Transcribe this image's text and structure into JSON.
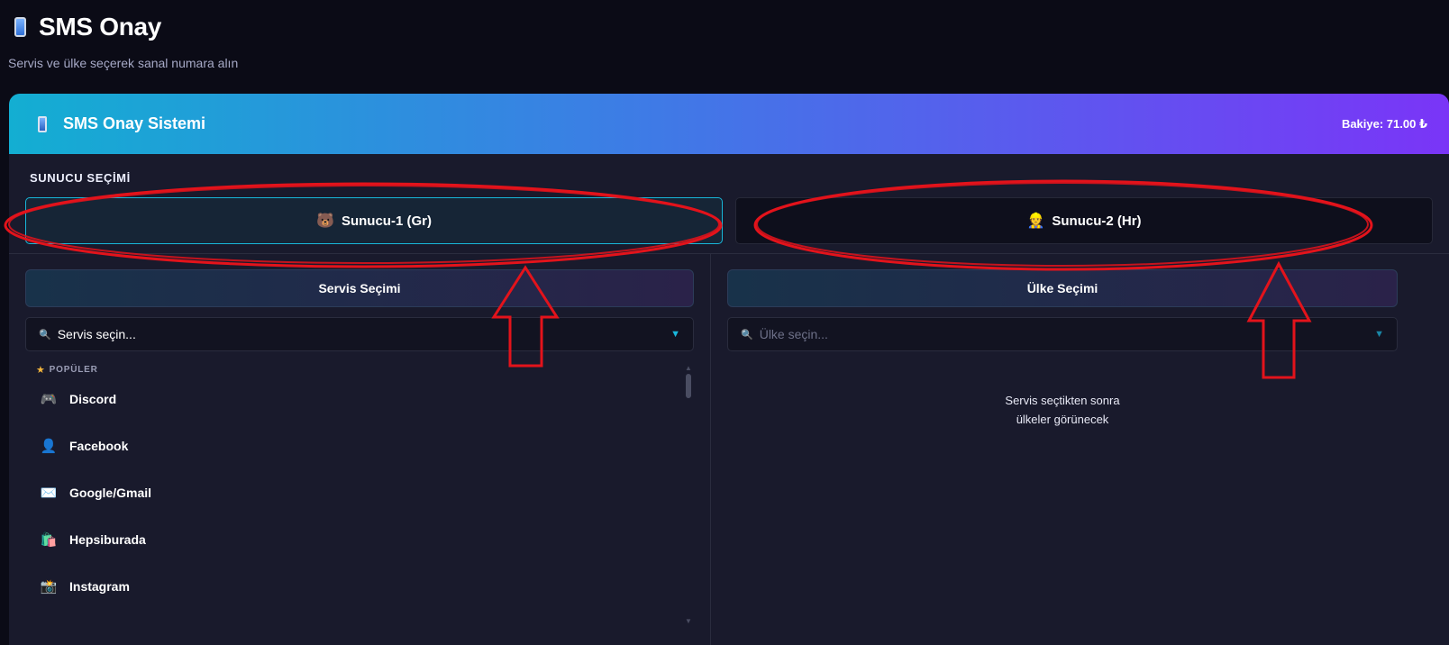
{
  "page": {
    "title": "SMS Onay",
    "subtitle": "Servis ve ülke seçerek sanal numara alın"
  },
  "card": {
    "title": "SMS Onay Sistemi",
    "balance": "Bakiye: 71.00 ₺"
  },
  "server_section": {
    "label": "SUNUCU SEÇİMİ",
    "servers": [
      {
        "emoji": "🐻",
        "label": "Sunucu-1 (Gr)",
        "active": true
      },
      {
        "emoji": "👷",
        "label": "Sunucu-2 (Hr)",
        "active": false
      }
    ]
  },
  "service": {
    "title": "Servis Seçimi",
    "select_value": "Servis seçin...",
    "group_label": "POPÜLER",
    "items": [
      {
        "icon": "🎮",
        "label": "Discord"
      },
      {
        "icon": "👤",
        "label": "Facebook"
      },
      {
        "icon": "✉️",
        "label": "Google/Gmail"
      },
      {
        "icon": "🛍️",
        "label": "Hepsiburada"
      },
      {
        "icon": "📸",
        "label": "Instagram"
      }
    ]
  },
  "country": {
    "title": "Ülke Seçimi",
    "select_placeholder": "Ülke seçin...",
    "empty_line1": "Servis seçtikten sonra",
    "empty_line2": "ülkeler görünecek"
  },
  "colors": {
    "accent": "#18b6d8",
    "header_gradient_start": "#13aed2",
    "header_gradient_end": "#7a35f7",
    "annotation_red": "#e3131b"
  }
}
